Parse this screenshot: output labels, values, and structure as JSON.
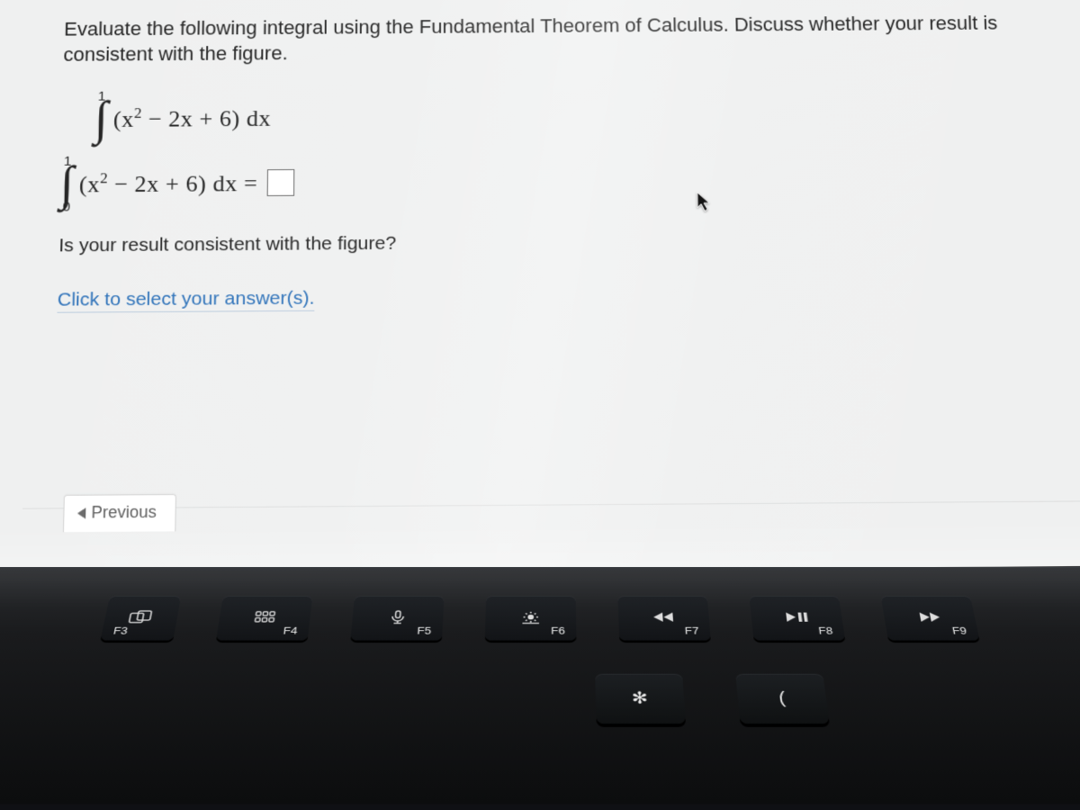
{
  "question": {
    "prompt": "Evaluate the following integral using the Fundamental Theorem of Calculus. Discuss whether your result is consistent with the figure.",
    "integral": {
      "lower": "0",
      "upper": "1",
      "integrand_display": "(x² − 2x + 6) dx"
    },
    "answer_line_prefix": "(x² − 2x + 6) dx =",
    "sub_question": "Is your result consistent with the figure?",
    "select_cta": "Click to select your answer(s)."
  },
  "nav": {
    "previous": "Previous"
  },
  "keyboard": {
    "f_keys": [
      {
        "name": "F3",
        "icon": "mission"
      },
      {
        "name": "F4",
        "icon": "grid"
      },
      {
        "name": "F5",
        "icon": "mic"
      },
      {
        "name": "F6",
        "icon": "focus"
      },
      {
        "name": "F7",
        "icon": "rewind"
      },
      {
        "name": "F8",
        "icon": "playpause"
      },
      {
        "name": "F9",
        "icon": "forward"
      }
    ],
    "row2_glyphs": [
      "✻",
      "("
    ]
  }
}
